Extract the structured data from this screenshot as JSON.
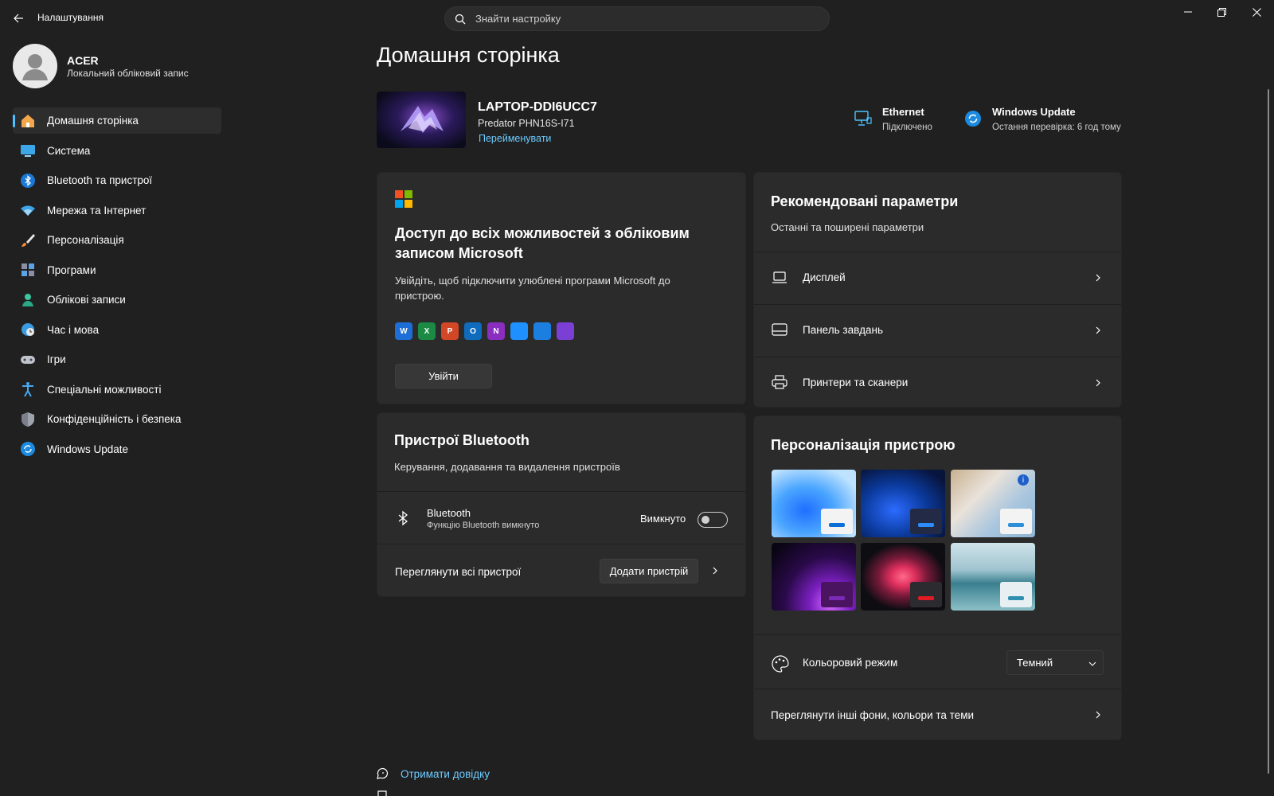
{
  "app": {
    "title": "Налаштування"
  },
  "search": {
    "placeholder": "Знайти настройку"
  },
  "user": {
    "name": "ACER",
    "account_type": "Локальний обліковий запис"
  },
  "sidebar": {
    "items": [
      {
        "label": "Домашня сторінка",
        "icon": "home-icon",
        "active": true
      },
      {
        "label": "Система",
        "icon": "system-icon"
      },
      {
        "label": "Bluetooth та пристрої",
        "icon": "bluetooth-icon"
      },
      {
        "label": "Мережа та Інтернет",
        "icon": "wifi-icon"
      },
      {
        "label": "Персоналізація",
        "icon": "brush-icon"
      },
      {
        "label": "Програми",
        "icon": "apps-icon"
      },
      {
        "label": "Облікові записи",
        "icon": "account-icon"
      },
      {
        "label": "Час і мова",
        "icon": "clock-globe-icon"
      },
      {
        "label": "Ігри",
        "icon": "gamepad-icon"
      },
      {
        "label": "Спеціальні можливості",
        "icon": "accessibility-icon"
      },
      {
        "label": "Конфіденційність і безпека",
        "icon": "shield-icon"
      },
      {
        "label": "Windows Update",
        "icon": "windows-update-icon"
      }
    ]
  },
  "main": {
    "title": "Домашня сторінка",
    "device": {
      "name": "LAPTOP-DDI6UCC7",
      "model": "Predator PHN16S-I71",
      "rename": "Перейменувати"
    },
    "status": {
      "ethernet": {
        "title": "Ethernet",
        "sub": "Підключено"
      },
      "update": {
        "title": "Windows Update",
        "sub": "Остання перевірка: 6 год тому"
      }
    },
    "ms_card": {
      "title": "Доступ до всіх можливостей з обліковим записом Microsoft",
      "desc": "Увійдіть, щоб підключити улюблені програми Microsoft до пристрою.",
      "signin": "Увійти",
      "apps": [
        {
          "name": "word-icon",
          "color": "#1e6ed8",
          "letter": "W"
        },
        {
          "name": "excel-icon",
          "color": "#1a8a44",
          "letter": "X"
        },
        {
          "name": "powerpoint-icon",
          "color": "#d24726",
          "letter": "P"
        },
        {
          "name": "outlook-icon",
          "color": "#0f6cbd",
          "letter": "O"
        },
        {
          "name": "onenote-icon",
          "color": "#8a2ec0",
          "letter": "N"
        },
        {
          "name": "onedrive-icon",
          "color": "#1e90ff",
          "letter": ""
        },
        {
          "name": "defender-icon",
          "color": "#1c7fe0",
          "letter": ""
        },
        {
          "name": "clipchamp-icon",
          "color": "#7b3fd6",
          "letter": ""
        }
      ]
    },
    "recommended": {
      "title": "Рекомендовані параметри",
      "subtitle": "Останні та поширені параметри",
      "items": [
        {
          "label": "Дисплей",
          "icon": "laptop-icon"
        },
        {
          "label": "Панель завдань",
          "icon": "taskbar-icon"
        },
        {
          "label": "Принтери та сканери",
          "icon": "printer-icon"
        }
      ]
    },
    "bluetooth": {
      "title": "Пристрої Bluetooth",
      "subtitle": "Керування, додавання та видалення пристроїв",
      "label": "Bluetooth",
      "sub": "Функцію Bluetooth вимкнуто",
      "state": "Вимкнуто",
      "view_all": "Переглянути всі пристрої",
      "add": "Додати пристрій"
    },
    "personalize": {
      "title": "Персоналізація пристрою",
      "color_mode_label": "Кольоровий режим",
      "color_mode_value": "Темний",
      "more": "Переглянути інші фони, кольори та теми"
    },
    "help": "Отримати довідку"
  },
  "colors": {
    "accent": "#4cc2ff",
    "link": "#6ccbff",
    "background": "#202020",
    "card": "#2b2b2b"
  }
}
